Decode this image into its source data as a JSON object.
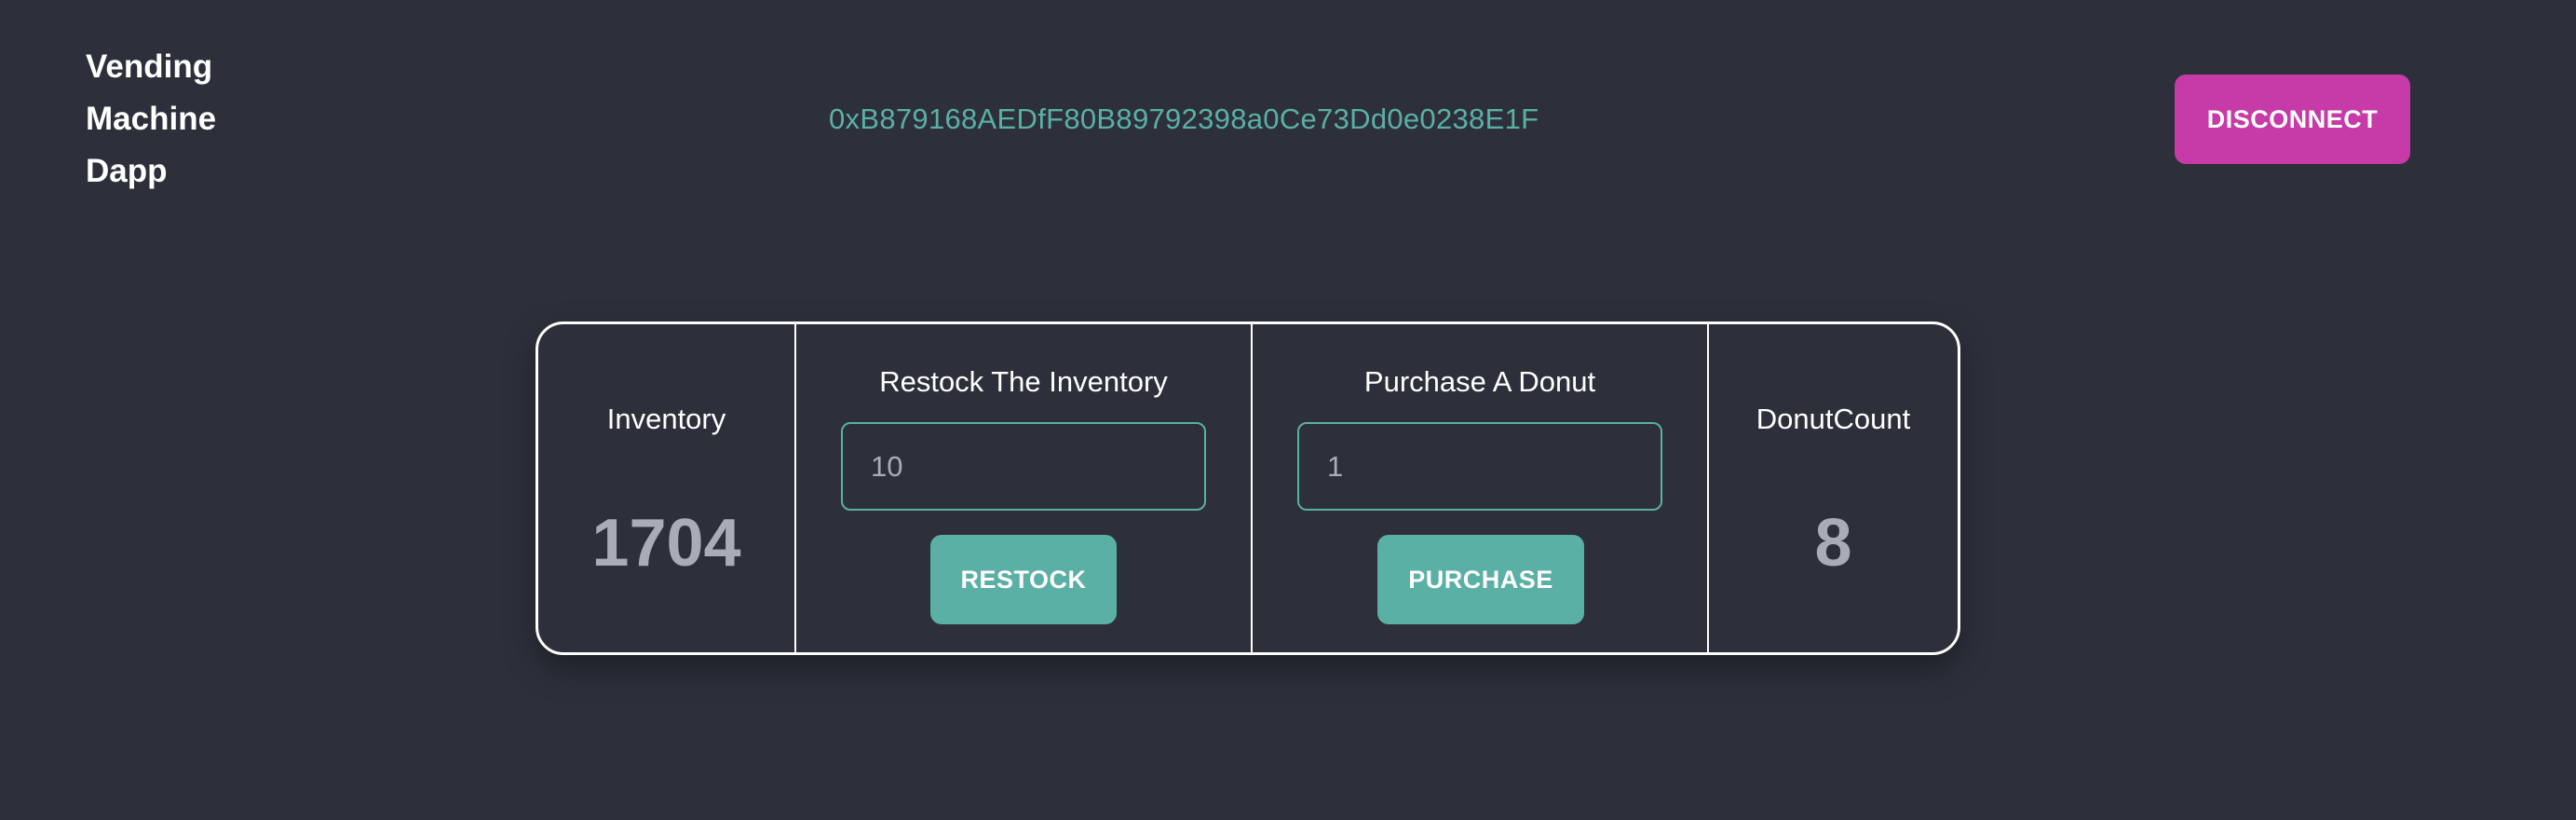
{
  "header": {
    "brand_lines": [
      "Vending",
      "Machine",
      "Dapp"
    ],
    "wallet_address": "0xB879168AEDfF80B89792398a0Ce73Dd0e0238E1F",
    "disconnect_label": "DISCONNECT"
  },
  "panel": {
    "inventory": {
      "label": "Inventory",
      "value": "1704"
    },
    "restock": {
      "title": "Restock The Inventory",
      "input_value": "10",
      "button_label": "RESTOCK"
    },
    "purchase": {
      "title": "Purchase A Donut",
      "input_value": "1",
      "button_label": "PURCHASE"
    },
    "donut_count": {
      "label": "DonutCount",
      "value": "8"
    }
  },
  "colors": {
    "background": "#2d303b",
    "accent_teal": "#5ab0a5",
    "accent_magenta": "#c63ba7",
    "muted_value": "#a9abb6"
  }
}
